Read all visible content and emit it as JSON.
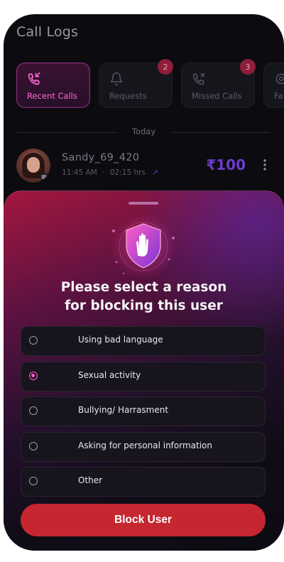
{
  "header": {
    "title": "Call Logs"
  },
  "tabs": [
    {
      "label": "Recent Calls",
      "icon": "phone-incoming-icon",
      "active": true,
      "badge": ""
    },
    {
      "label": "Requests",
      "icon": "bell-icon",
      "active": false,
      "badge": "2"
    },
    {
      "label": "Missed Calls",
      "icon": "phone-missed-icon",
      "active": false,
      "badge": "3"
    },
    {
      "label": "Fa",
      "icon": "target-icon",
      "active": false,
      "badge": ""
    }
  ],
  "section": {
    "label": "Today"
  },
  "call": {
    "name": "Sandy_69_420",
    "time": "11:45 AM",
    "duration": "02:15 hrs",
    "amount": "₹100"
  },
  "sheet": {
    "icon": "hand-shield-icon",
    "title": "Please select a reason\nfor blocking this user",
    "reasons": [
      {
        "label": "Using bad language",
        "selected": false
      },
      {
        "label": "Sexual activity",
        "selected": true
      },
      {
        "label": "Bullying/ Harrasment",
        "selected": false
      },
      {
        "label": "Asking for personal information",
        "selected": false
      },
      {
        "label": "Other",
        "selected": false
      }
    ],
    "button_label": "Block User"
  },
  "colors": {
    "accent_pink": "#ff5fd2",
    "accent_purple": "#6e3cc9",
    "danger": "#c5262f",
    "background": "#0b0b10"
  }
}
